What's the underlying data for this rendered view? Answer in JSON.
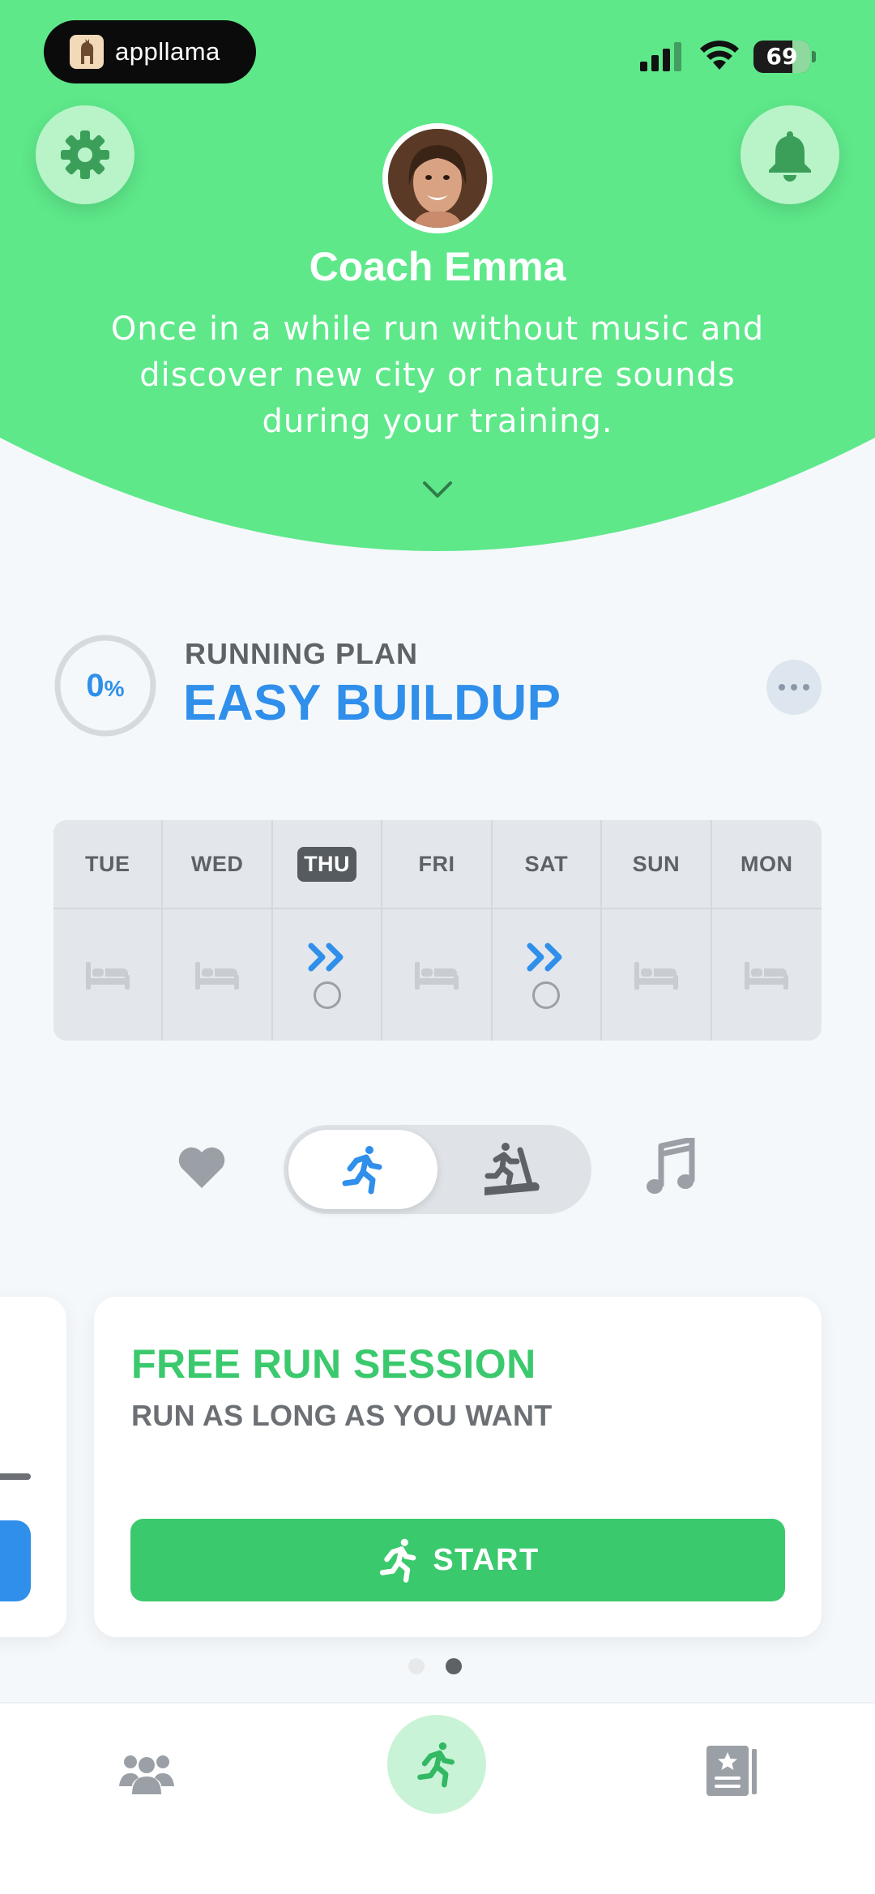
{
  "status_bar": {
    "app_badge_name": "appllama",
    "battery_percent": "69",
    "battery_level": 0.69,
    "icons": [
      "signal-icon",
      "wifi-icon",
      "battery-icon"
    ]
  },
  "header": {
    "background_color": "#5ee88a",
    "coach_name": "Coach Emma",
    "coach_tip": "Once in a while run without music and discover new city or nature sounds during your training.",
    "icons": [
      "gear-icon",
      "bell-icon",
      "chevron-down-icon"
    ]
  },
  "plan": {
    "progress_value": "0",
    "progress_unit": "%",
    "progress_fraction": 0,
    "label": "RUNNING PLAN",
    "name": "EASY BUILDUP",
    "accent_color": "#2f8fea"
  },
  "week": {
    "days": [
      {
        "label": "TUE",
        "type": "rest"
      },
      {
        "label": "WED",
        "type": "rest"
      },
      {
        "label": "THU",
        "type": "run",
        "today": true
      },
      {
        "label": "FRI",
        "type": "rest"
      },
      {
        "label": "SAT",
        "type": "run"
      },
      {
        "label": "SUN",
        "type": "rest"
      },
      {
        "label": "MON",
        "type": "rest"
      }
    ]
  },
  "modes": {
    "selected": "outdoor",
    "options": [
      "outdoor-run-icon",
      "treadmill-icon"
    ],
    "side_icons": [
      "heart-icon",
      "music-note-icon"
    ]
  },
  "cards": {
    "active_index": 1,
    "count": 2,
    "free_run": {
      "title": "FREE RUN SESSION",
      "subtitle": "RUN AS LONG AS YOU WANT",
      "start_label": "START",
      "color": "#3bc96d"
    }
  },
  "tabbar": {
    "items": [
      {
        "name": "community",
        "icon": "people-icon"
      },
      {
        "name": "run",
        "icon": "runner-icon",
        "active": true
      },
      {
        "name": "log",
        "icon": "logbook-icon"
      }
    ]
  }
}
